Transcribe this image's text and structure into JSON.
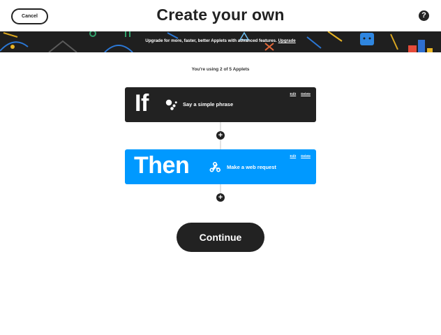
{
  "header": {
    "cancel_label": "Cancel",
    "title": "Create your own",
    "help_icon": "question-mark-icon",
    "help_glyph": "?"
  },
  "banner": {
    "text": "Upgrade for more, faster, better Applets with advanced features.",
    "link_label": "Upgrade"
  },
  "usage_text": "You're using 2 of 5 Applets",
  "trigger": {
    "keyword": "If",
    "label": "Say a simple phrase",
    "icon": "google-assistant-icon",
    "edit_label": "Edit",
    "delete_label": "Delete"
  },
  "action": {
    "keyword": "Then",
    "label": "Make a web request",
    "icon": "webhooks-icon",
    "edit_label": "Edit",
    "delete_label": "Delete"
  },
  "add_glyph": "+",
  "continue_label": "Continue",
  "colors": {
    "trigger_card": "#222222",
    "action_card": "#0099ff",
    "dark": "#222222"
  }
}
